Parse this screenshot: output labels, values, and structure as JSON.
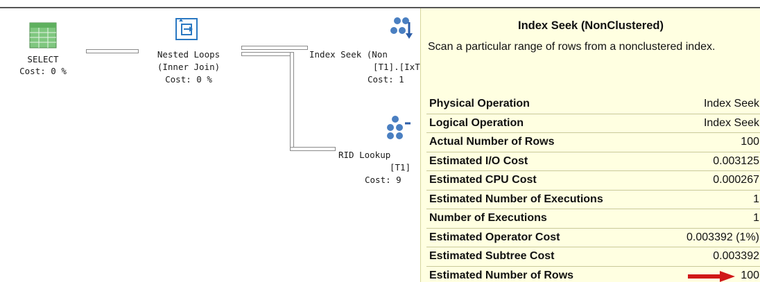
{
  "plan": {
    "select": {
      "name": "SELECT",
      "cost": "Cost: 0 %"
    },
    "nested_loops": {
      "name": "Nested Loops",
      "type": "(Inner Join)",
      "cost": "Cost: 0 %"
    },
    "index_seek": {
      "name": "Index Seek (Non",
      "object": "[T1].[IxT",
      "cost": "Cost: 1"
    },
    "rid_lookup": {
      "name": "RID Lookup",
      "object": "[T1]",
      "cost": "Cost: 9"
    }
  },
  "tooltip": {
    "title": "Index Seek (NonClustered)",
    "description": "Scan a particular range of rows from a nonclustered index.",
    "rows": [
      {
        "label": "Physical Operation",
        "value": "Index Seek"
      },
      {
        "label": "Logical Operation",
        "value": "Index Seek"
      },
      {
        "label": "Actual Number of Rows",
        "value": "100"
      },
      {
        "label": "Estimated I/O Cost",
        "value": "0.003125"
      },
      {
        "label": "Estimated CPU Cost",
        "value": "0.000267"
      },
      {
        "label": "Estimated Number of Executions",
        "value": "1"
      },
      {
        "label": "Number of Executions",
        "value": "1"
      },
      {
        "label": "Estimated Operator Cost",
        "value": "0.003392 (1%)"
      },
      {
        "label": "Estimated Subtree Cost",
        "value": "0.003392"
      },
      {
        "label": "Estimated Number of Rows",
        "value": "100"
      }
    ]
  },
  "colors": {
    "tooltip_bg": "#ffffe1",
    "highlight_arrow": "#d01818"
  },
  "icons": {
    "select": "table-grid-icon",
    "nested_loops": "loop-join-icon",
    "index_seek": "index-seek-icon",
    "rid_lookup": "rid-lookup-icon",
    "highlight": "red-arrow-icon"
  }
}
